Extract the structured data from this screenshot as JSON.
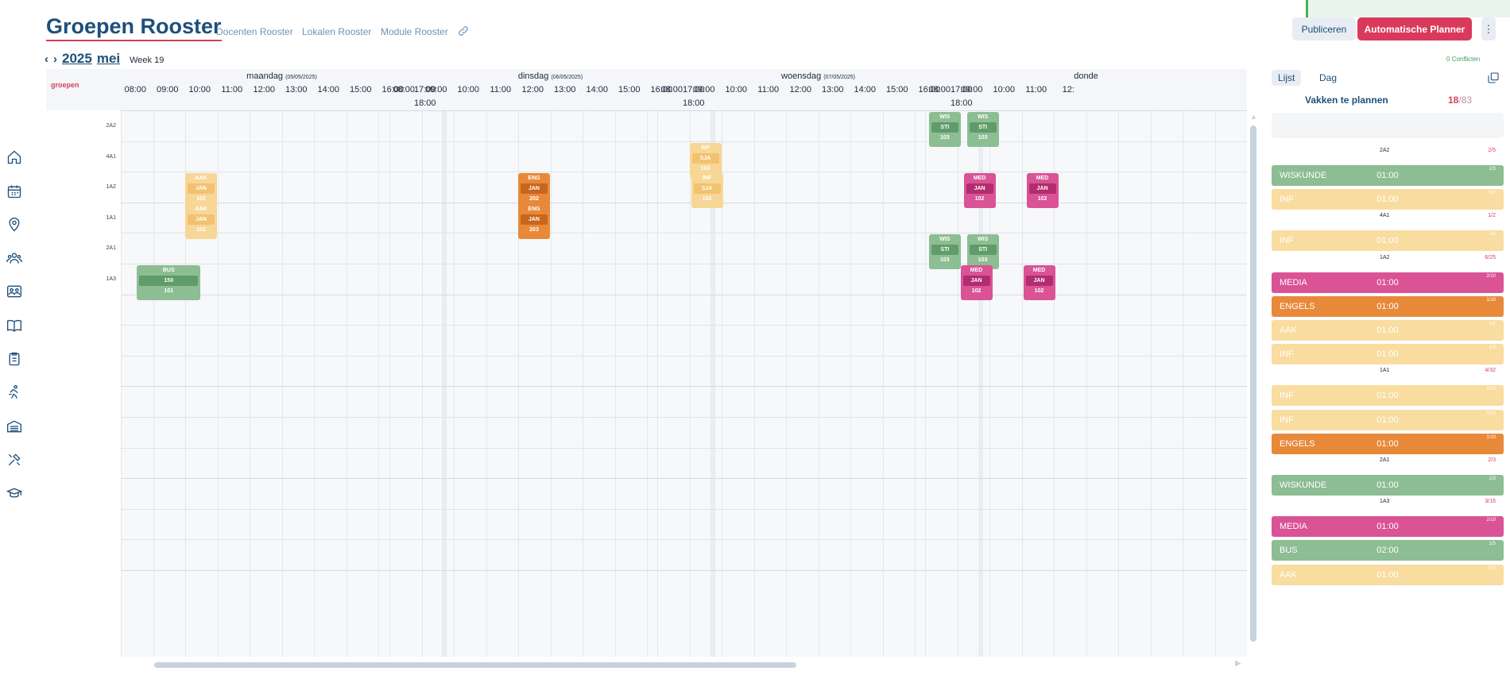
{
  "header": {
    "title": "Groepen Rooster",
    "nav": [
      "Docenten Rooster",
      "Lokalen Rooster",
      "Module Rooster"
    ],
    "publish": "Publiceren",
    "auto_planner": "Automatische Planner",
    "more": "⋮"
  },
  "datenav": {
    "prev": "‹",
    "next": "›",
    "year": "2025",
    "month": "mei",
    "week": "Week 19"
  },
  "conflicts": "0 Conflicten",
  "grid": {
    "corner_label": "groepen",
    "days": [
      {
        "name": "maandag",
        "date": "(05/05/2025)"
      },
      {
        "name": "dinsdag",
        "date": "(06/05/2025)"
      },
      {
        "name": "woensdag",
        "date": "(07/05/2025)"
      },
      {
        "name": "donde",
        "date": ""
      }
    ],
    "hours": [
      "08:00",
      "09:00",
      "10:00",
      "11:00",
      "12:00",
      "13:00",
      "14:00",
      "15:00",
      "16:00",
      "17:00"
    ],
    "hours_last_partial": "12:",
    "end_hour": "18:00",
    "rows": [
      "2A2",
      "4A1",
      "1A2",
      "1A1",
      "2A1",
      "1A3"
    ],
    "events": [
      {
        "day": 0,
        "row": 2,
        "col": 2,
        "color": "yellow",
        "subject": "AAK",
        "teacher": "JAN",
        "room": "102"
      },
      {
        "day": 0,
        "row": 3,
        "col": 2,
        "color": "yellow",
        "subject": "AAK",
        "teacher": "JAN",
        "room": "102"
      },
      {
        "day": 0,
        "row": 5,
        "col": 0.5,
        "color": "green",
        "wide": true,
        "subject": "BUS",
        "teacher": "150",
        "room": "101"
      },
      {
        "day": 1,
        "row": 2,
        "col": 4,
        "color": "orange",
        "subject": "ENG",
        "teacher": "JAN",
        "room": "202"
      },
      {
        "day": 1,
        "row": 3,
        "col": 4,
        "color": "orange",
        "subject": "ENG",
        "teacher": "JAN",
        "room": "203"
      },
      {
        "day": 2,
        "row": 1,
        "col": 1,
        "color": "yellow",
        "subject": "INF",
        "teacher": "SJA",
        "room": "103"
      },
      {
        "day": 2,
        "row": 2,
        "col": 1.05,
        "color": "yellow",
        "subject": "INF",
        "teacher": "SJA",
        "room": "102"
      },
      {
        "day": 3,
        "row": 0,
        "col": 0.12,
        "color": "green",
        "subject": "WIS",
        "teacher": "STI",
        "room": "103"
      },
      {
        "day": 3,
        "row": 0,
        "col": 1.3,
        "color": "green",
        "subject": "WIS",
        "teacher": "STI",
        "room": "103"
      },
      {
        "day": 3,
        "row": 4,
        "col": 0.12,
        "color": "green",
        "subject": "WIS",
        "teacher": "STI",
        "room": "103"
      },
      {
        "day": 3,
        "row": 4,
        "col": 1.3,
        "color": "green",
        "subject": "WIS",
        "teacher": "STI",
        "room": "103"
      },
      {
        "day": 3,
        "row": 2,
        "col": 1.2,
        "color": "pink",
        "subject": "MED",
        "teacher": "JAN",
        "room": "102"
      },
      {
        "day": 3,
        "row": 2,
        "col": 3.15,
        "color": "pink",
        "subject": "MED",
        "teacher": "JAN",
        "room": "102"
      },
      {
        "day": 3,
        "row": 5,
        "col": 1.1,
        "color": "pink",
        "subject": "MED",
        "teacher": "JAN",
        "room": "102"
      },
      {
        "day": 3,
        "row": 5,
        "col": 3.05,
        "color": "pink",
        "subject": "MED",
        "teacher": "JAN",
        "room": "102"
      }
    ]
  },
  "panel": {
    "tabs": [
      "Lijst",
      "Dag"
    ],
    "heading": "Vakken te plannen",
    "count_done": "18",
    "count_total": "/83",
    "entries": [
      {
        "type": "group",
        "name": "2A2",
        "count": "2/5"
      },
      {
        "type": "item",
        "color": "green",
        "name": "WISKUNDE",
        "time": "01:00",
        "frac": "2/3"
      },
      {
        "type": "item",
        "color": "yellow",
        "name": "INF",
        "time": "01:00",
        "frac": "0/2"
      },
      {
        "type": "group",
        "name": "4A1",
        "count": "1/2"
      },
      {
        "type": "item",
        "color": "yellow",
        "name": "INF",
        "time": "01:00",
        "frac": "1/2"
      },
      {
        "type": "group",
        "name": "1A2",
        "count": "6/25"
      },
      {
        "type": "item",
        "color": "pink",
        "name": "MEDIA",
        "time": "01:00",
        "frac": "2/10"
      },
      {
        "type": "item",
        "color": "orange",
        "name": "ENGELS",
        "time": "01:00",
        "frac": "1/10"
      },
      {
        "type": "item",
        "color": "yellow",
        "name": "AAK",
        "time": "01:00",
        "frac": "1/2"
      },
      {
        "type": "item",
        "color": "yellow",
        "name": "INF",
        "time": "01:00",
        "frac": "1/3"
      },
      {
        "type": "group",
        "name": "1A1",
        "count": "4/32"
      },
      {
        "type": "item",
        "color": "yellow",
        "name": "INF",
        "time": "01:00",
        "frac": "1/10"
      },
      {
        "type": "item",
        "color": "yellow",
        "name": "INF",
        "time": "01:00",
        "frac": "0/10"
      },
      {
        "type": "item",
        "color": "orange",
        "name": "ENGELS",
        "time": "01:00",
        "frac": "1/10"
      },
      {
        "type": "group",
        "name": "2A1",
        "count": "2/3"
      },
      {
        "type": "item",
        "color": "green",
        "name": "WISKUNDE",
        "time": "01:00",
        "frac": "2/3"
      },
      {
        "type": "group",
        "name": "1A3",
        "count": "3/16"
      },
      {
        "type": "item",
        "color": "pink",
        "name": "MEDIA",
        "time": "01:00",
        "frac": "2/10"
      },
      {
        "type": "item",
        "color": "green",
        "name": "BUS",
        "time": "02:00",
        "frac": "1/5"
      },
      {
        "type": "item",
        "color": "yellow",
        "name": "AAK",
        "time": "01:00",
        "frac": "0/2"
      }
    ]
  },
  "sidebar_icons": [
    "home-icon",
    "calendar-icon",
    "location-pin-icon",
    "users-icon",
    "classroom-icon",
    "book-icon",
    "clipboard-icon",
    "activity-icon",
    "building-icon",
    "tools-icon",
    "graduation-icon"
  ],
  "colors": {
    "brand": "#1e4f7a",
    "accent": "#d93a5b",
    "green": "#8cbd93",
    "yellow": "#f7d795",
    "orange": "#e8893a",
    "pink": "#d95395"
  }
}
